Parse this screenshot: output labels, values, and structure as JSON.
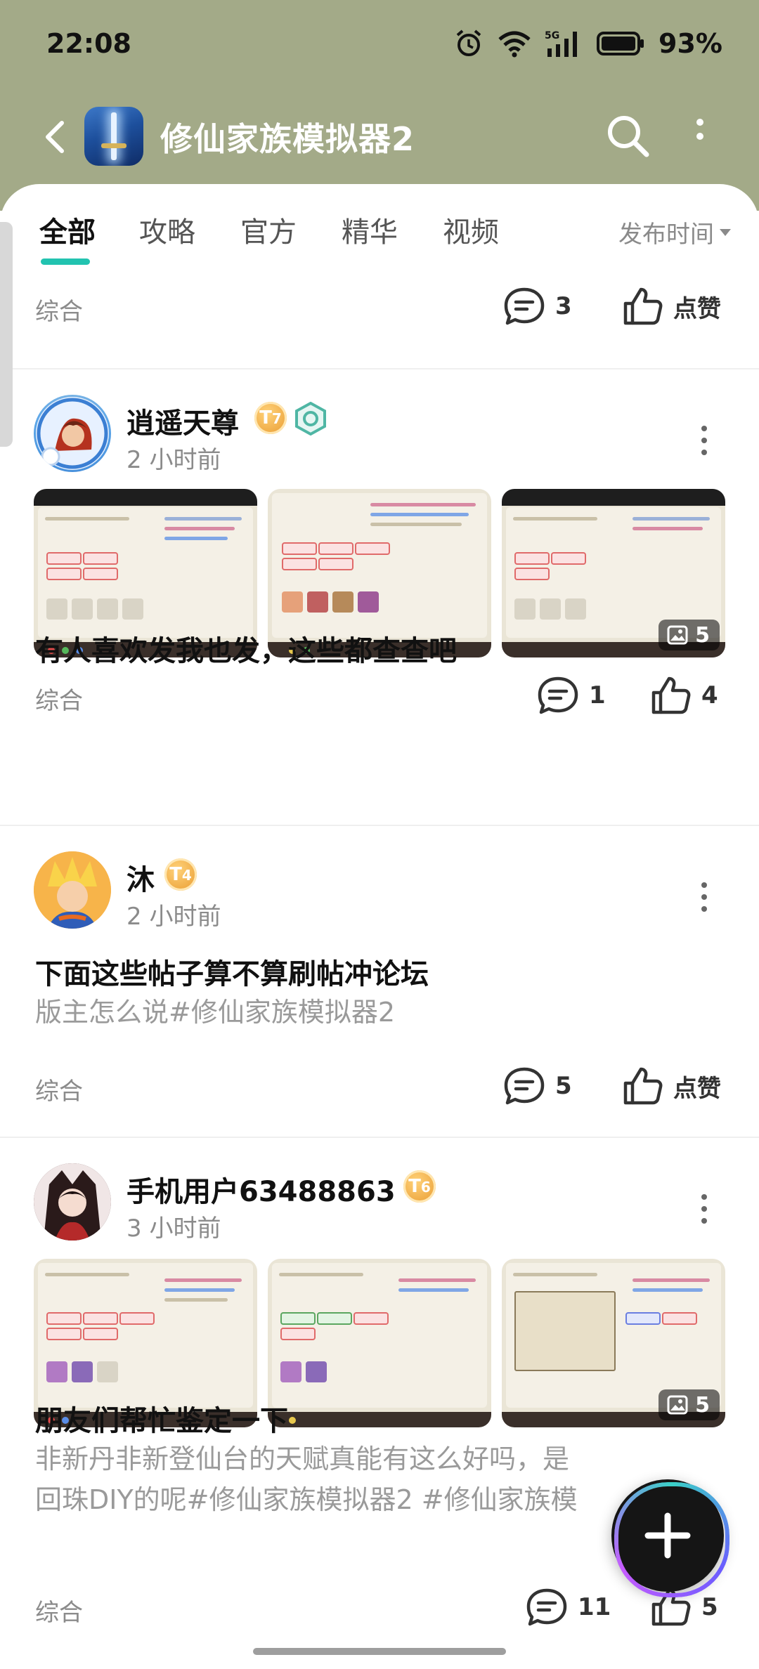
{
  "status_bar": {
    "time": "22:08",
    "battery": "93%"
  },
  "header": {
    "title": "修仙家族模拟器2"
  },
  "tabs": [
    {
      "label": "全部",
      "active": true
    },
    {
      "label": "攻略",
      "active": false
    },
    {
      "label": "官方",
      "active": false
    },
    {
      "label": "精华",
      "active": false
    },
    {
      "label": "视频",
      "active": false
    }
  ],
  "sort": {
    "label": "发布时间"
  },
  "posts": [
    {
      "category": "综合",
      "comments": "3",
      "likes": "点赞"
    },
    {
      "username": "逍遥天尊",
      "level": "7",
      "time": "2 小时前",
      "image_count": "5",
      "title": "有人喜欢发我也发，这些都查查吧",
      "category": "综合",
      "comments": "1",
      "likes": "4"
    },
    {
      "username": "沐",
      "level": "4",
      "time": "2 小时前",
      "title": "下面这些帖子算不算刷帖冲论坛",
      "body": "版主怎么说#修仙家族模拟器2",
      "category": "综合",
      "comments": "5",
      "likes": "点赞"
    },
    {
      "username": "手机用户63488863",
      "level": "6",
      "time": "3 小时前",
      "image_count": "5",
      "title": "朋友们帮忙鉴定一下",
      "body_line1": "非新丹非新登仙台的天赋真能有这么好吗，是",
      "body_line2": "回珠DIY的呢#修仙家族模拟器2 #修仙家族模",
      "category": "综合",
      "comments": "11",
      "likes": "5"
    }
  ],
  "colors": {
    "header_bg": "#a3aa88",
    "accent": "#22c3b0",
    "badge_orange": "#e89a2f"
  }
}
